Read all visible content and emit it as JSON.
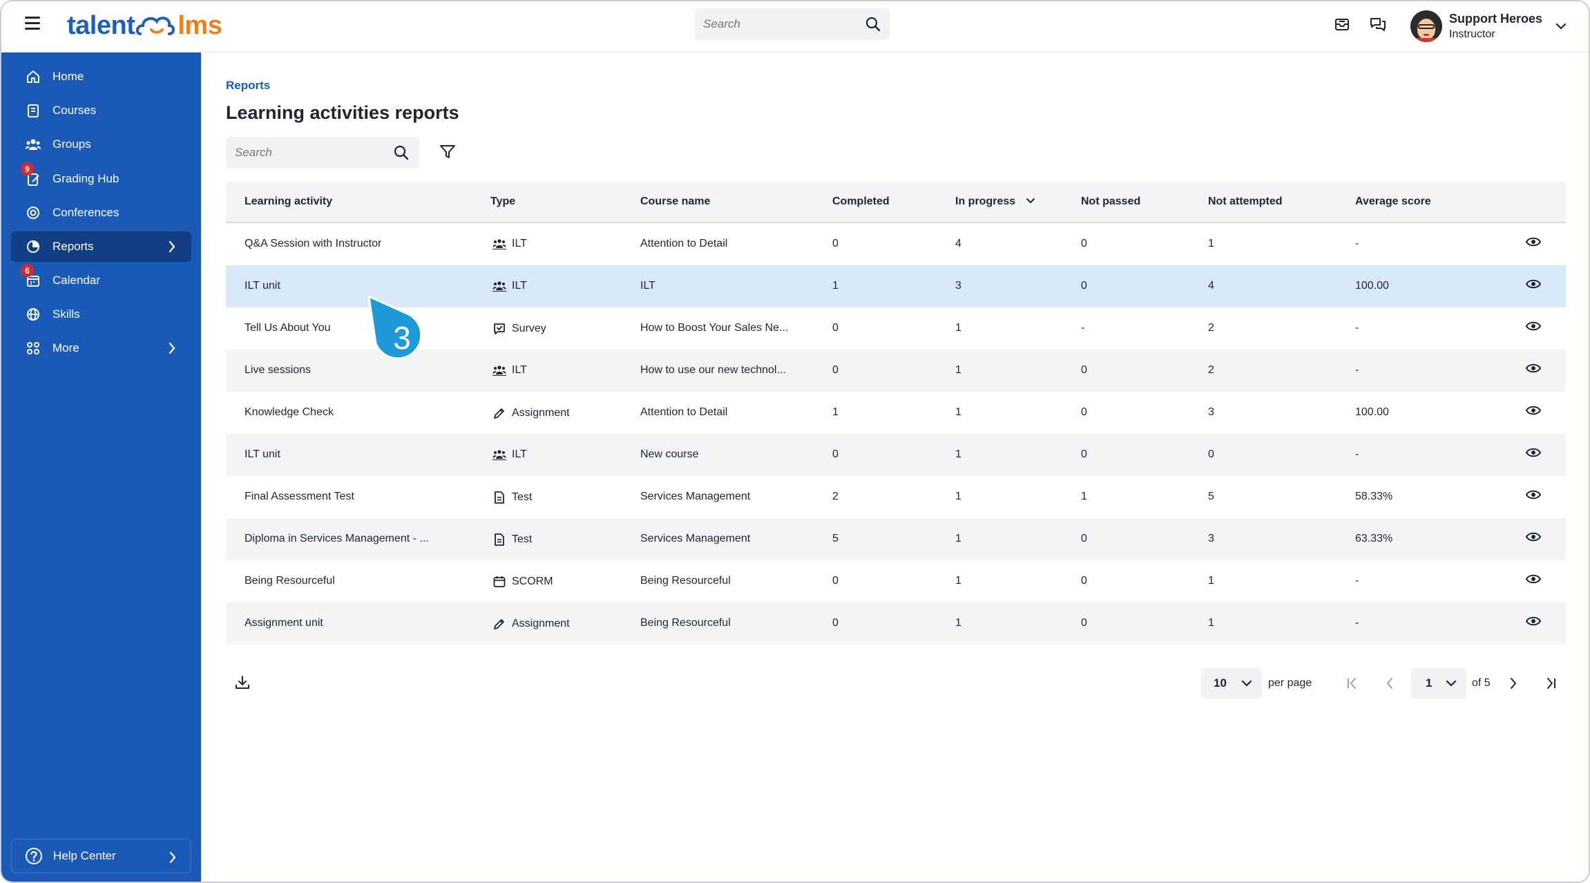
{
  "app": {
    "logo_left": "talent",
    "logo_right": "lms"
  },
  "topbar": {
    "search_placeholder": "Search",
    "user_name": "Support Heroes",
    "user_role": "Instructor"
  },
  "sidebar": {
    "items": [
      {
        "label": "Home",
        "icon": "home-icon"
      },
      {
        "label": "Courses",
        "icon": "courses-icon"
      },
      {
        "label": "Groups",
        "icon": "groups-icon"
      },
      {
        "label": "Grading Hub",
        "icon": "grading-icon",
        "badge": "9"
      },
      {
        "label": "Conferences",
        "icon": "conferences-icon"
      },
      {
        "label": "Reports",
        "icon": "reports-icon",
        "active": true
      },
      {
        "label": "Calendar",
        "icon": "calendar-icon",
        "badge": "6"
      },
      {
        "label": "Skills",
        "icon": "skills-icon"
      },
      {
        "label": "More",
        "icon": "more-icon"
      }
    ],
    "help_label": "Help Center"
  },
  "main": {
    "breadcrumb": "Reports",
    "title": "Learning activities reports",
    "search_placeholder": "Search"
  },
  "table": {
    "headers": [
      "Learning activity",
      "Type",
      "Course name",
      "Completed",
      "In progress",
      "Not passed",
      "Not attempted",
      "Average score"
    ],
    "rows": [
      {
        "activity": "Q&A Session with Instructor",
        "type": "ILT",
        "type_icon": "ilt-icon",
        "course": "Attention to Detail",
        "completed": "0",
        "in_progress": "4",
        "not_passed": "0",
        "not_attempted": "1",
        "avg": "-"
      },
      {
        "activity": "ILT unit",
        "type": "ILT",
        "type_icon": "ilt-icon",
        "course": "ILT",
        "completed": "1",
        "in_progress": "3",
        "not_passed": "0",
        "not_attempted": "4",
        "avg": "100.00"
      },
      {
        "activity": "Tell Us About You",
        "type": "Survey",
        "type_icon": "survey-icon",
        "course": "How to Boost Your Sales Ne...",
        "completed": "0",
        "in_progress": "1",
        "not_passed": "-",
        "not_attempted": "2",
        "avg": "-"
      },
      {
        "activity": "Live sessions",
        "type": "ILT",
        "type_icon": "ilt-icon",
        "course": "How to use our new technol...",
        "completed": "0",
        "in_progress": "1",
        "not_passed": "0",
        "not_attempted": "2",
        "avg": "-"
      },
      {
        "activity": "Knowledge Check",
        "type": "Assignment",
        "type_icon": "assignment-icon",
        "course": "Attention to Detail",
        "completed": "1",
        "in_progress": "1",
        "not_passed": "0",
        "not_attempted": "3",
        "avg": "100.00"
      },
      {
        "activity": "ILT unit",
        "type": "ILT",
        "type_icon": "ilt-icon",
        "course": "New course",
        "completed": "0",
        "in_progress": "1",
        "not_passed": "0",
        "not_attempted": "0",
        "avg": "-"
      },
      {
        "activity": "Final Assessment Test",
        "type": "Test",
        "type_icon": "test-icon",
        "course": "Services Management",
        "completed": "2",
        "in_progress": "1",
        "not_passed": "1",
        "not_attempted": "5",
        "avg": "58.33%"
      },
      {
        "activity": "Diploma in Services Management - ...",
        "type": "Test",
        "type_icon": "test-icon",
        "course": "Services Management",
        "completed": "5",
        "in_progress": "1",
        "not_passed": "0",
        "not_attempted": "3",
        "avg": "63.33%"
      },
      {
        "activity": "Being Resourceful",
        "type": "SCORM",
        "type_icon": "scorm-icon",
        "course": "Being Resourceful",
        "completed": "0",
        "in_progress": "1",
        "not_passed": "0",
        "not_attempted": "1",
        "avg": "-"
      },
      {
        "activity": "Assignment unit",
        "type": "Assignment",
        "type_icon": "assignment-icon",
        "course": "Being Resourceful",
        "completed": "0",
        "in_progress": "1",
        "not_passed": "0",
        "not_attempted": "1",
        "avg": "-"
      }
    ]
  },
  "pagination": {
    "per_page": "10",
    "per_page_label": "per page",
    "current_page": "1",
    "of_label": "of 5"
  },
  "callout": {
    "number": "3"
  },
  "colors": {
    "sidebar": "#1a5ab6",
    "sidebar_active": "#123f83",
    "highlight_row": "#d9e8f8",
    "callout": "#1e9ad9",
    "badge": "#d8282f"
  }
}
